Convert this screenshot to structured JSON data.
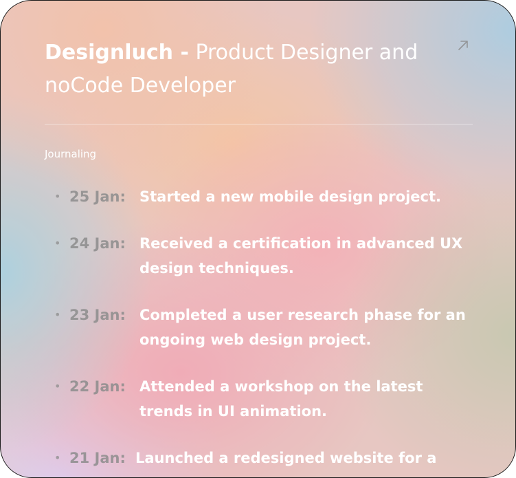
{
  "header": {
    "brand": "Designluch -",
    "tagline": " Product Designer and noCode Developer",
    "link_icon": "external-arrow-icon"
  },
  "section": {
    "label": "Journaling"
  },
  "entries": [
    {
      "date": "25 Jan:",
      "text": "Started a new mobile design project."
    },
    {
      "date": "24 Jan:",
      "text": "Received a certification in advanced UX design techniques."
    },
    {
      "date": "23 Jan:",
      "text": "Completed a user research phase for an ongoing web design project."
    },
    {
      "date": "22 Jan:",
      "text": "Attended a workshop on the latest trends in UI animation."
    },
    {
      "date": "21 Jan:",
      "text": "Launched a redesigned website for a"
    }
  ],
  "colors": {
    "text": "#ffffff",
    "date": "#8c8c8c",
    "border": "#1a1a1a"
  }
}
